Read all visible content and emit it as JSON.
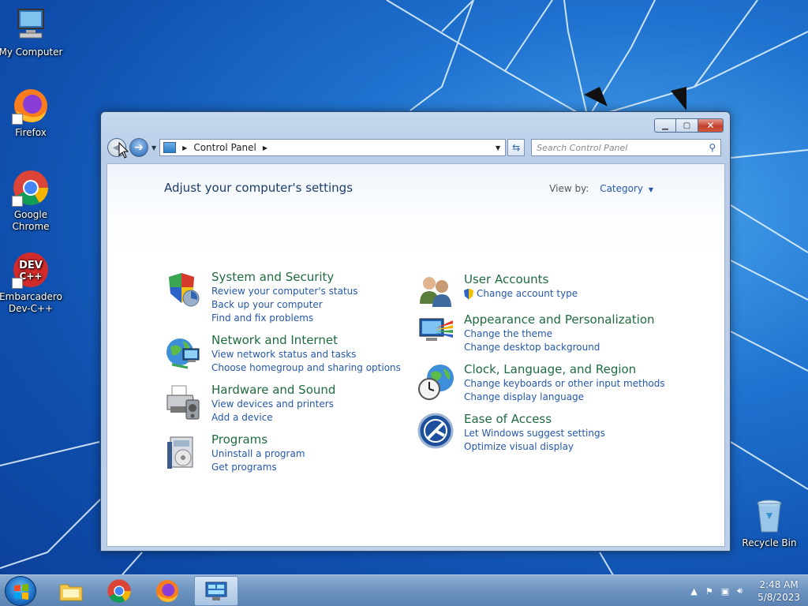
{
  "desktop": {
    "icons": [
      {
        "label": "My Computer"
      },
      {
        "label": "Firefox"
      },
      {
        "label": "Google Chrome"
      },
      {
        "label": "Embarcadero Dev-C++"
      },
      {
        "label": "Recycle Bin"
      }
    ]
  },
  "window": {
    "address": {
      "segment": "Control Panel"
    },
    "search": {
      "placeholder": "Search Control Panel"
    },
    "heading": "Adjust your computer's settings",
    "view_by": {
      "label": "View by:",
      "value": "Category"
    },
    "categories_left": [
      {
        "title": "System and Security",
        "links": [
          "Review your computer's status",
          "Back up your computer",
          "Find and fix problems"
        ]
      },
      {
        "title": "Network and Internet",
        "links": [
          "View network status and tasks",
          "Choose homegroup and sharing options"
        ]
      },
      {
        "title": "Hardware and Sound",
        "links": [
          "View devices and printers",
          "Add a device"
        ]
      },
      {
        "title": "Programs",
        "links": [
          "Uninstall a program",
          "Get programs"
        ]
      }
    ],
    "categories_right": [
      {
        "title": "User Accounts",
        "links": [
          "Change account type"
        ]
      },
      {
        "title": "Appearance and Personalization",
        "links": [
          "Change the theme",
          "Change desktop background"
        ]
      },
      {
        "title": "Clock, Language, and Region",
        "links": [
          "Change keyboards or other input methods",
          "Change display language"
        ]
      },
      {
        "title": "Ease of Access",
        "links": [
          "Let Windows suggest settings",
          "Optimize visual display"
        ]
      }
    ]
  },
  "taskbar": {
    "clock": {
      "time": "2:48 AM",
      "date": "5/8/2023"
    }
  }
}
